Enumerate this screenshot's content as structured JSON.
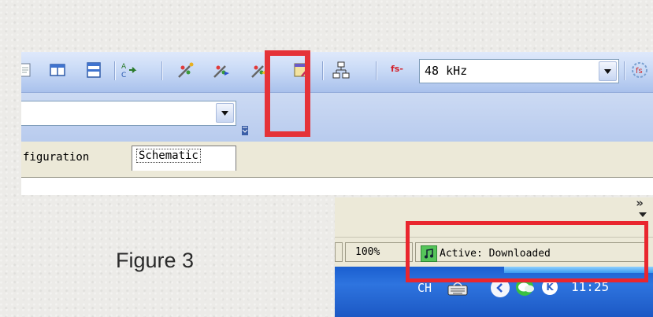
{
  "toolbar": {
    "icons": [
      "document-icon",
      "split-vertical-icon",
      "split-horizontal-icon",
      "sort-az-icon",
      "wand-icon",
      "wand-blue-icon",
      "wand-yellow-icon",
      "edit-form-icon",
      "hierarchy-icon",
      "fs-icon",
      "settings-hex-icon"
    ],
    "fs_label": "fs-",
    "sample_rate": "48 kHz"
  },
  "tabs": {
    "configuration": "figuration",
    "schematic": "Schematic"
  },
  "status_bar": {
    "zoom": "100%",
    "status": "Active: Downloaded",
    "overflow_chevron": "»"
  },
  "taskbar": {
    "language": "CH",
    "clock": "11:25",
    "k_badge": "K"
  },
  "caption": "Figure 3",
  "colors": {
    "highlight": "#e53238",
    "toolbar_blue": "#c9daf6",
    "taskbar_blue": "#2e74df"
  }
}
